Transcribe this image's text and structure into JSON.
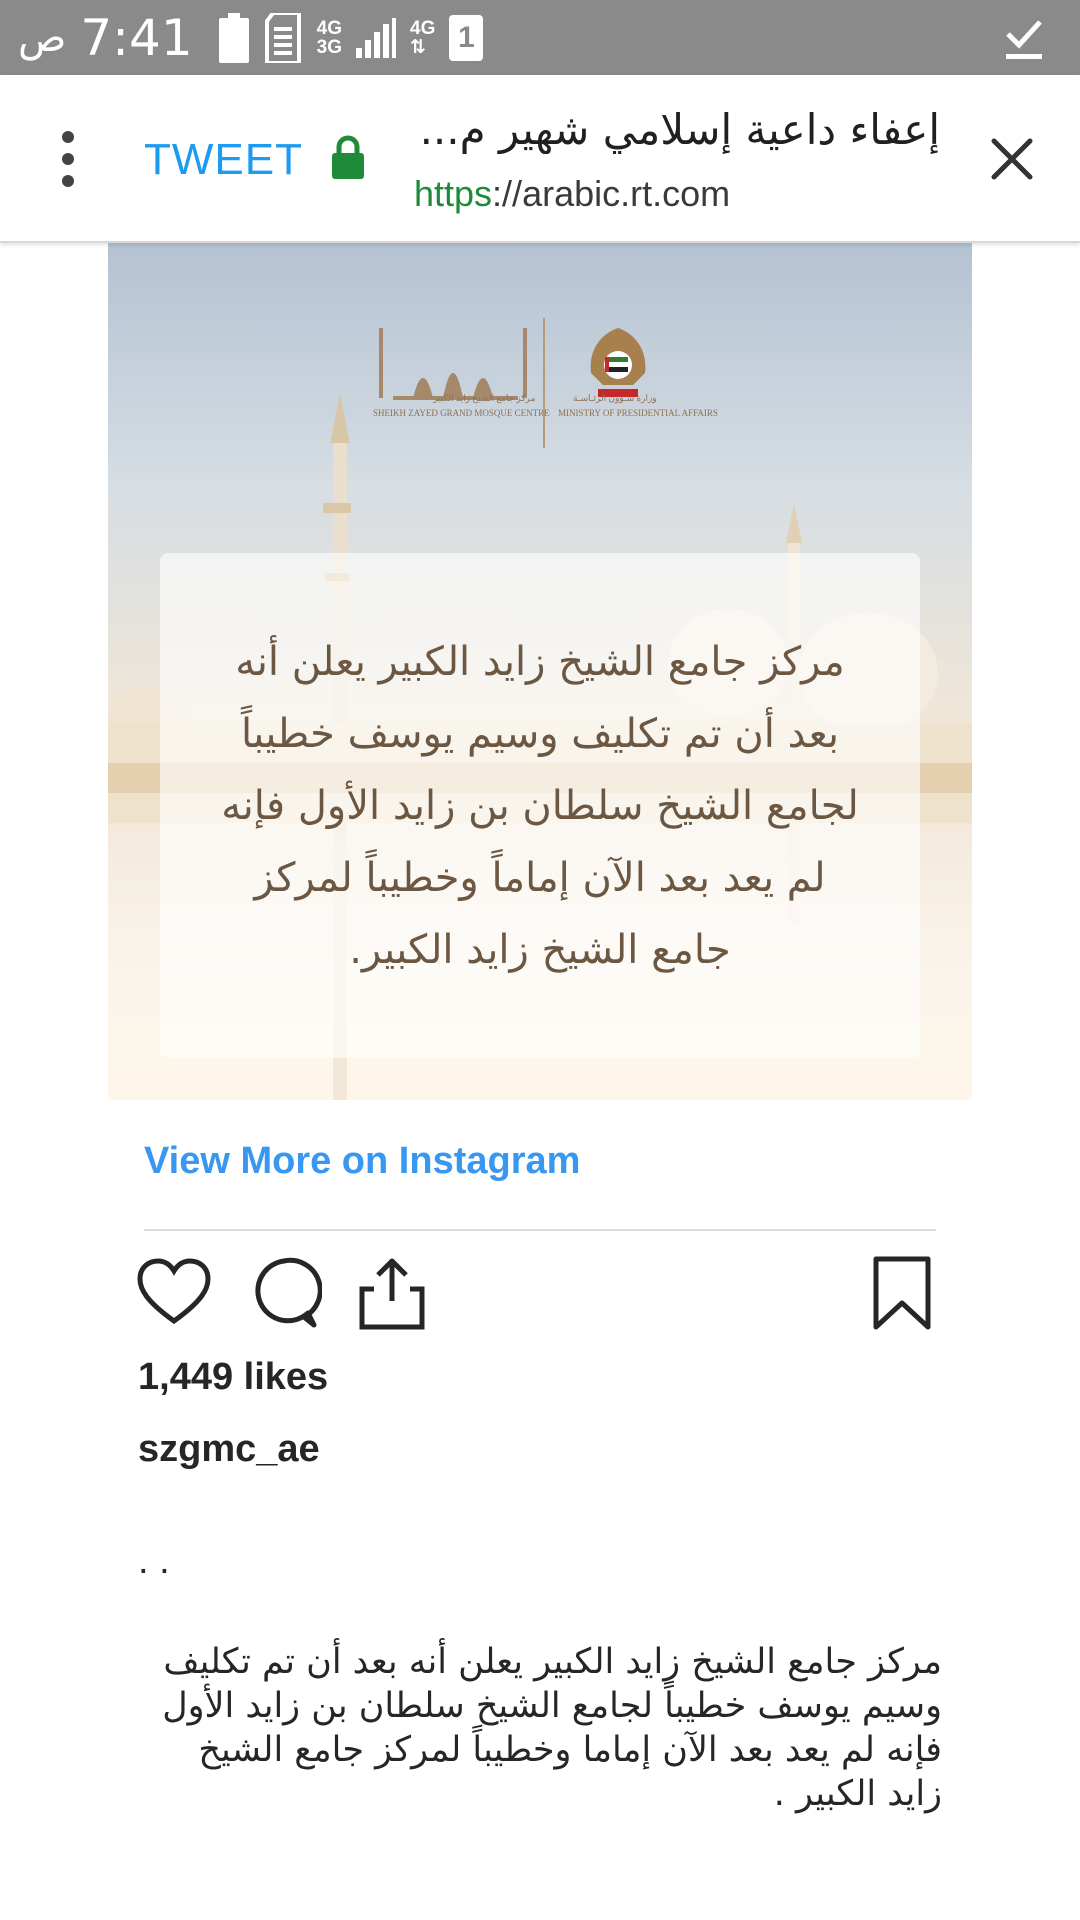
{
  "status_bar": {
    "ampm": "ص",
    "time": "7:41",
    "network_top": "4G",
    "network_bottom": "3G",
    "network_data": "4G",
    "sim_slot": "1"
  },
  "toolbar": {
    "tweet_label": "TWEET",
    "page_title": "إعفاء داعية إسلامي شهير م...",
    "url_scheme": "https",
    "url_sep": "://",
    "url_host": "arabic.rt.com"
  },
  "post_image": {
    "logo_mosque_ar": "مركز جامع الشيخ زايد الكبير",
    "logo_mosque_en": "SHEIKH ZAYED GRAND MOSQUE CENTRE",
    "logo_ministry_ar": "وزارة شـؤون الرئـاسـة",
    "logo_ministry_en": "MINISTRY OF PRESIDENTIAL AFFAIRS",
    "announcement_lines": [
      "مركز جامع الشيخ زايد الكبير يعلن أنه",
      "بعد أن تم تكليف وسيم يوسف خطيباً",
      "لجامع الشيخ سلطان بن زايد الأول فإنه",
      "لم يعد بعد الآن إماماً وخطيباً لمركز",
      "جامع الشيخ زايد الكبير."
    ]
  },
  "embed": {
    "view_more": "View More on Instagram",
    "likes": "1,449 likes",
    "username": "szgmc_ae",
    "caption_dots": ". .",
    "caption_lines": [
      "مركز جامع الشيخ زايد الكبير يعلن أنه بعد أن تم تكليف",
      "وسيم يوسف خطيباً لجامع الشيخ سلطان بن زايد الأول",
      "فإنه لم يعد بعد الآن إماما وخطيباً لمركز جامع الشيخ",
      "زايد الكبير ."
    ]
  },
  "colors": {
    "status_bar": "#8a8a8a",
    "tweet": "#1d9bf0",
    "secure_green": "#1e8a3a",
    "instagram_link": "#3897f0"
  }
}
